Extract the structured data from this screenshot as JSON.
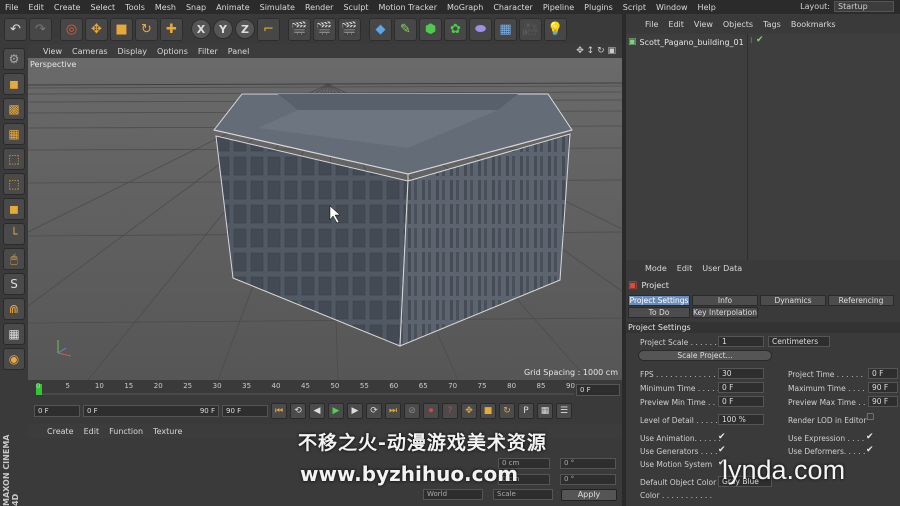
{
  "menubar": {
    "items": [
      "File",
      "Edit",
      "Create",
      "Select",
      "Tools",
      "Mesh",
      "Snap",
      "Animate",
      "Simulate",
      "Render",
      "Sculpt",
      "Motion Tracker",
      "MoGraph",
      "Character",
      "Pipeline",
      "Plugins",
      "Script",
      "Window",
      "Help"
    ],
    "layout_label": "Layout:",
    "layout_value": "Startup"
  },
  "toolbar": {
    "axis_x": "X",
    "axis_y": "Y",
    "axis_z": "Z"
  },
  "viewport": {
    "menu": [
      "View",
      "Cameras",
      "Display",
      "Options",
      "Filter",
      "Panel"
    ],
    "label": "Perspective",
    "grid_spacing": "Grid Spacing : 1000 cm"
  },
  "timeline": {
    "ticks": [
      "0",
      "5",
      "10",
      "15",
      "20",
      "25",
      "30",
      "35",
      "40",
      "45",
      "50",
      "55",
      "60",
      "65",
      "70",
      "75",
      "80",
      "85",
      "90"
    ],
    "current_frame": "0 F"
  },
  "anim": {
    "start": "0 F",
    "range_start": "0 F",
    "range_end": "90 F",
    "end": "90 F"
  },
  "material": {
    "menu": [
      "Create",
      "Edit",
      "Function",
      "Texture"
    ],
    "coord_x": "0 cm",
    "coord_y": "0 cm",
    "coord_z": "0 cm",
    "coord_h": "0 °",
    "coord_p": "0 °",
    "coord_b": "0 °",
    "world": "World",
    "scale": "Scale",
    "apply": "Apply"
  },
  "objects": {
    "menu": [
      "File",
      "Edit",
      "View",
      "Objects",
      "Tags",
      "Bookmarks"
    ],
    "items": [
      {
        "name": "Scott_Pagano_building_01"
      }
    ]
  },
  "attributes": {
    "menu": [
      "Mode",
      "Edit",
      "User Data"
    ],
    "title": "Project",
    "tabs": [
      "Project Settings",
      "Info",
      "Dynamics",
      "Referencing",
      "To Do",
      "Key Interpolation"
    ],
    "section": "Project Settings",
    "project_scale_label": "Project Scale . . . . . .",
    "project_scale_value": "1",
    "units": "Centimeters",
    "scale_project": "Scale Project...",
    "fps_label": "FPS . . . . . . . . . . . . .",
    "fps": "30",
    "project_time_label": "Project Time . . . . . .",
    "project_time": "0 F",
    "min_time_label": "Minimum Time . . . . .",
    "min_time": "0 F",
    "max_time_label": "Maximum Time . . . .",
    "max_time": "90 F",
    "prev_min_label": "Preview Min Time . .",
    "prev_min": "0 F",
    "prev_max_label": "Preview Max Time . .",
    "prev_max": "90 F",
    "lod_label": "Level of Detail . . . . .",
    "lod": "100 %",
    "render_lod_label": "Render LOD in Editor",
    "use_animation": "Use Animation. . . . . .",
    "use_expression": "Use Expression . . . .",
    "use_generators": "Use Generators . . . .",
    "use_deformers": "Use Deformers. . . . .",
    "use_motion": "Use Motion System",
    "default_color_label": "Default Object Color",
    "default_color_value": "Gray Blue",
    "color_label": "Color . . . . . . . . . . ."
  },
  "watermarks": {
    "line1": "不移之火-动漫游戏美术资源",
    "line2": "www.byzhihuo.com",
    "brand": "lynda.com",
    "maxon": "MAXON CINEMA 4D"
  },
  "colors": {
    "accent": "#e8a83a",
    "active_tab": "#6a8cb8",
    "timeline_marker": "#35c335"
  }
}
